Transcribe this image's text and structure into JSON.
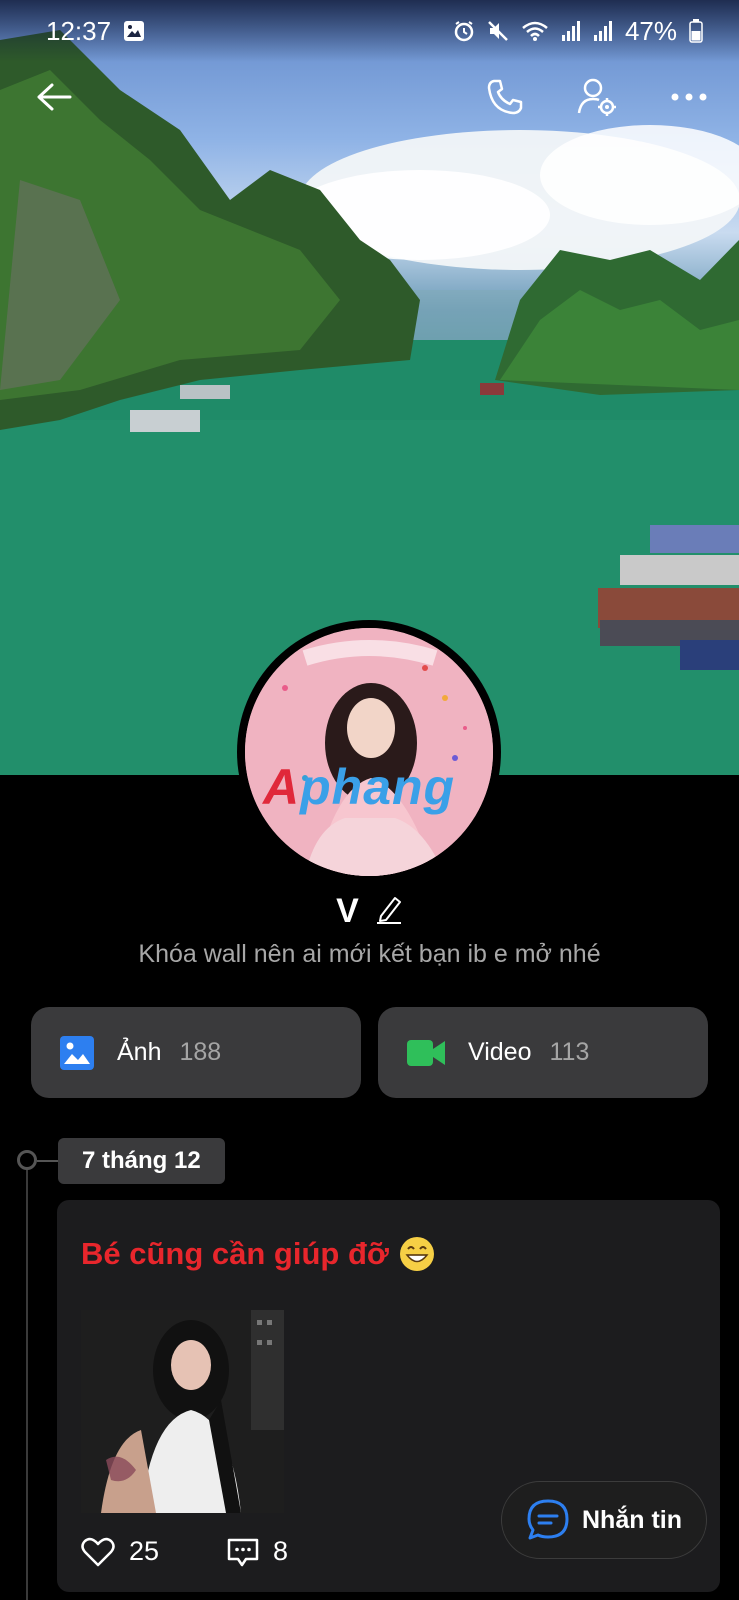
{
  "status_bar": {
    "time": "12:37",
    "battery": "47%"
  },
  "profile": {
    "name": "V",
    "bio": "Khóa wall nên ai mới kết bạn ib e mở nhé",
    "avatar_watermark": "Aphang"
  },
  "media": {
    "photos_label": "Ảnh",
    "photos_count": "188",
    "videos_label": "Video",
    "videos_count": "113"
  },
  "timeline": {
    "date": "7 tháng 12",
    "post": {
      "text": "Bé cũng cần giúp đỡ",
      "likes": "25",
      "comments": "8"
    }
  },
  "message_button": {
    "label": "Nhắn tin"
  },
  "colors": {
    "background": "#000000",
    "card": "#3a3a3c",
    "post_text": "#e8262c",
    "photo_icon": "#2d7ff0",
    "video_icon": "#2fbf5a"
  }
}
